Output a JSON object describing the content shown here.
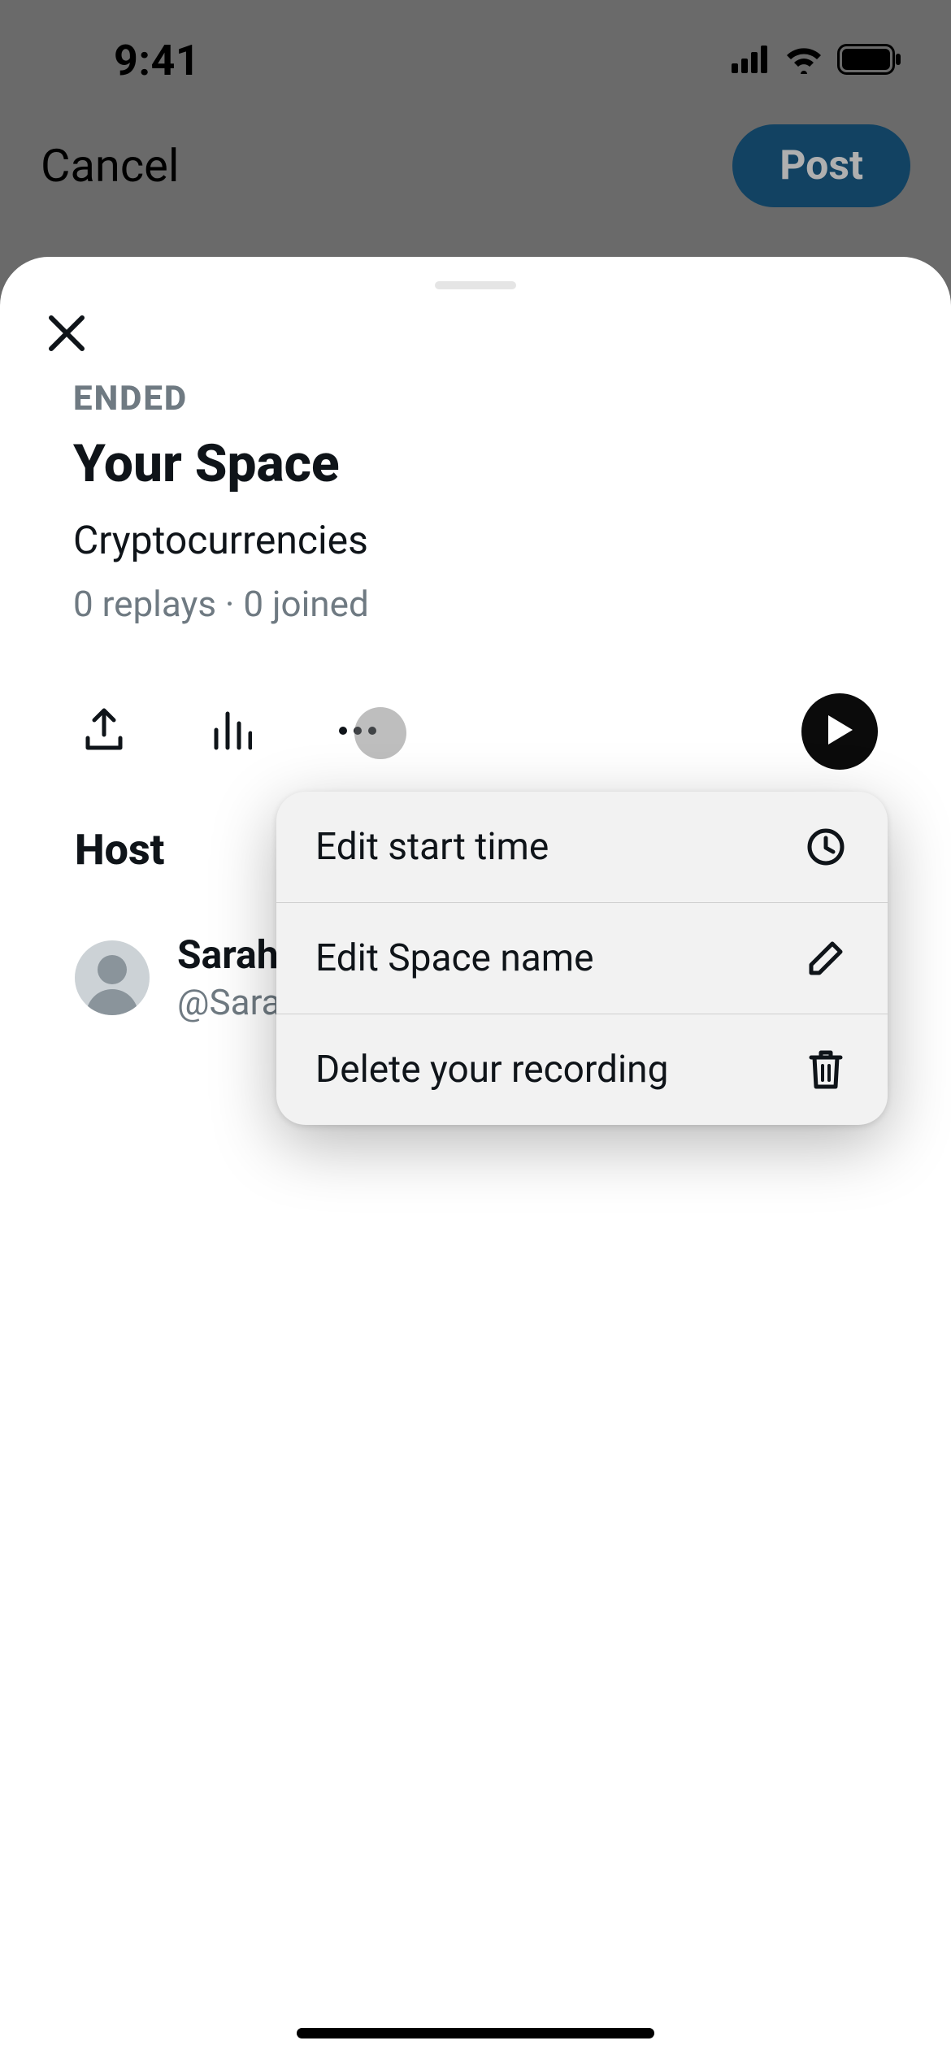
{
  "status_bar": {
    "time": "9:41"
  },
  "composer": {
    "cancel_label": "Cancel",
    "post_label": "Post"
  },
  "sheet": {
    "status": "ENDED",
    "title": "Your Space",
    "topic": "Cryptocurrencies",
    "stats": "0 replays · 0 joined",
    "host_heading": "Host",
    "host": {
      "name": "Sarah",
      "handle": "@Sara"
    }
  },
  "menu": {
    "items": [
      {
        "label": "Edit start time",
        "icon": "clock-icon"
      },
      {
        "label": "Edit Space name",
        "icon": "pencil-icon"
      },
      {
        "label": "Delete your recording",
        "icon": "trash-icon"
      }
    ]
  }
}
